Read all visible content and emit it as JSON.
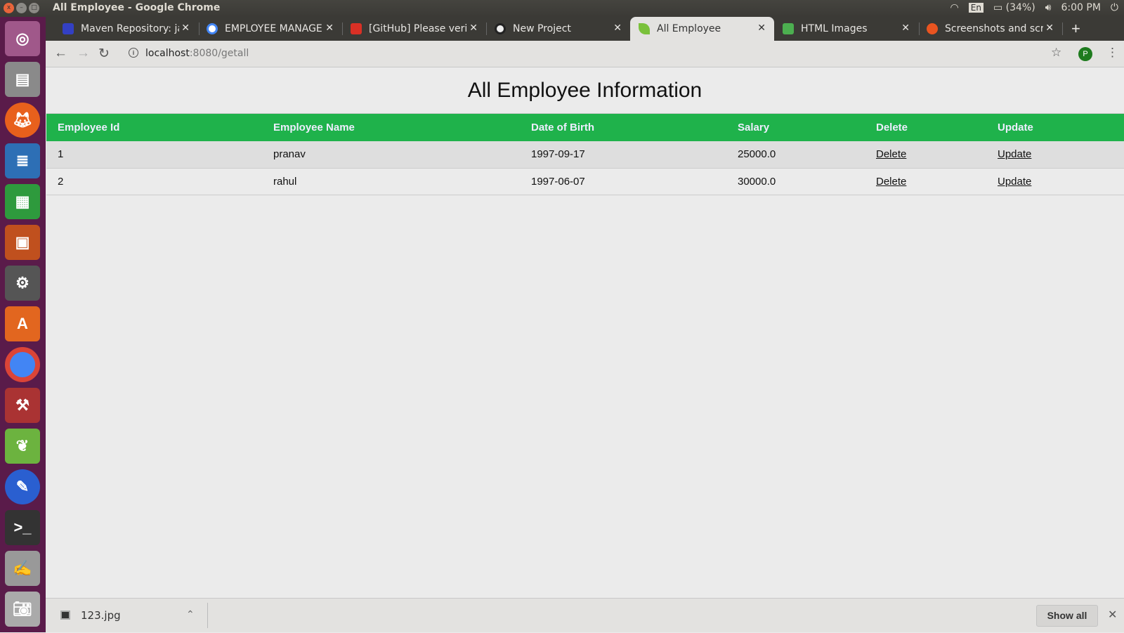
{
  "window": {
    "title": "All Employee - Google Chrome"
  },
  "tray": {
    "lang": "En",
    "battery": "(34%)",
    "time": "6:00 PM"
  },
  "tabs": [
    {
      "label": "Maven Repository: ja",
      "color": "#3340c4"
    },
    {
      "label": "EMPLOYEE MANAGE",
      "color": "#4285f4"
    },
    {
      "label": "[GitHub] Please verif",
      "color": "#d93025"
    },
    {
      "label": "New Project",
      "color": "#222222"
    },
    {
      "label": "All Employee",
      "color": "#7ac13b"
    },
    {
      "label": "HTML Images",
      "color": "#4caf50"
    },
    {
      "label": "Screenshots and scre",
      "color": "#e95420"
    }
  ],
  "address": {
    "host": "localhost",
    "rest": ":8080/getall",
    "avatar": "P"
  },
  "page": {
    "title": "All Employee Information",
    "columns": [
      "Employee Id",
      "Employee Name",
      "Date of Birth",
      "Salary",
      "Delete",
      "Update"
    ],
    "rows": [
      {
        "id": "1",
        "name": "pranav",
        "dob": "1997-09-17",
        "salary": "25000.0",
        "delete": "Delete",
        "update": "Update"
      },
      {
        "id": "2",
        "name": "rahul",
        "dob": "1997-06-07",
        "salary": "30000.0",
        "delete": "Delete",
        "update": "Update"
      }
    ]
  },
  "downloads": {
    "file": "123.jpg",
    "show_all": "Show all"
  },
  "colors": {
    "header_green": "#1fb24b",
    "launcher": "#5a1b4a"
  }
}
